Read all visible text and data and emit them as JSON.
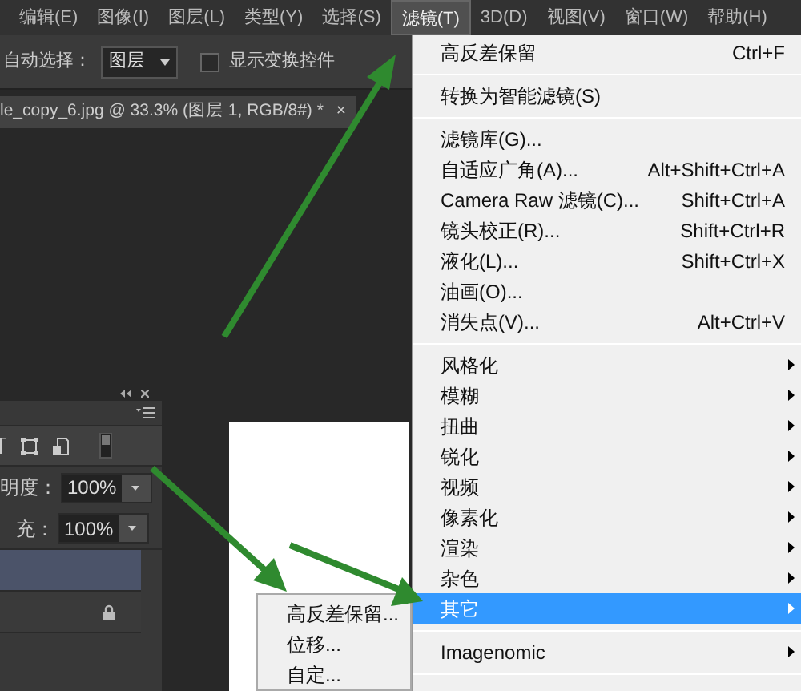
{
  "menubar": [
    {
      "label": "编辑(E)",
      "selected": false
    },
    {
      "label": "图像(I)",
      "selected": false
    },
    {
      "label": "图层(L)",
      "selected": false
    },
    {
      "label": "类型(Y)",
      "selected": false
    },
    {
      "label": "选择(S)",
      "selected": false
    },
    {
      "label": "滤镜(T)",
      "selected": true
    },
    {
      "label": "3D(D)",
      "selected": false
    },
    {
      "label": "视图(V)",
      "selected": false
    },
    {
      "label": "窗口(W)",
      "selected": false
    },
    {
      "label": "帮助(H)",
      "selected": false
    }
  ],
  "options_bar": {
    "auto_select_label": "自动选择：",
    "layer_dropdown": "图层",
    "show_transform": {
      "label": "显示变换控件",
      "checked": false
    }
  },
  "document_tab": {
    "title": "le_copy_6.jpg @ 33.3% (图层 1, RGB/8#) *",
    "close": "×"
  },
  "layers_panel": {
    "opacity_label": "明度：",
    "opacity": "100%",
    "fill_label": "充：",
    "fill": "100%",
    "layers": [
      {
        "selected": true,
        "locked": false
      },
      {
        "selected": false,
        "locked": true
      }
    ]
  },
  "filter_menu": {
    "items": [
      {
        "kind": "item",
        "label": "高反差保留",
        "shortcut": "Ctrl+F",
        "selected": false
      },
      {
        "kind": "separator"
      },
      {
        "kind": "item",
        "label": "转换为智能滤镜(S)",
        "selected": false
      },
      {
        "kind": "separator"
      },
      {
        "kind": "item",
        "label": "滤镜库(G)...",
        "selected": false
      },
      {
        "kind": "item",
        "label": "自适应广角(A)...",
        "shortcut": "Alt+Shift+Ctrl+A",
        "selected": false
      },
      {
        "kind": "item",
        "label": "Camera Raw 滤镜(C)...",
        "shortcut": "Shift+Ctrl+A",
        "selected": false
      },
      {
        "kind": "item",
        "label": "镜头校正(R)...",
        "shortcut": "Shift+Ctrl+R",
        "selected": false
      },
      {
        "kind": "item",
        "label": "液化(L)...",
        "shortcut": "Shift+Ctrl+X",
        "selected": false
      },
      {
        "kind": "item",
        "label": "油画(O)...",
        "selected": false
      },
      {
        "kind": "item",
        "label": "消失点(V)...",
        "shortcut": "Alt+Ctrl+V",
        "selected": false
      },
      {
        "kind": "separator"
      },
      {
        "kind": "submenu",
        "label": "风格化",
        "selected": false
      },
      {
        "kind": "submenu",
        "label": "模糊",
        "selected": false
      },
      {
        "kind": "submenu",
        "label": "扭曲",
        "selected": false
      },
      {
        "kind": "submenu",
        "label": "锐化",
        "selected": false
      },
      {
        "kind": "submenu",
        "label": "视频",
        "selected": false
      },
      {
        "kind": "submenu",
        "label": "像素化",
        "selected": false
      },
      {
        "kind": "submenu",
        "label": "渲染",
        "selected": false
      },
      {
        "kind": "submenu",
        "label": "杂色",
        "selected": false
      },
      {
        "kind": "submenu",
        "label": "其它",
        "selected": true
      },
      {
        "kind": "separator"
      },
      {
        "kind": "submenu",
        "label": "Imagenomic",
        "selected": false
      },
      {
        "kind": "separator"
      }
    ]
  },
  "submenu": {
    "items": [
      {
        "label": "高反差保留...",
        "selected": false
      },
      {
        "label": "位移...",
        "selected": false
      },
      {
        "label": "自定...",
        "selected": false
      }
    ]
  }
}
